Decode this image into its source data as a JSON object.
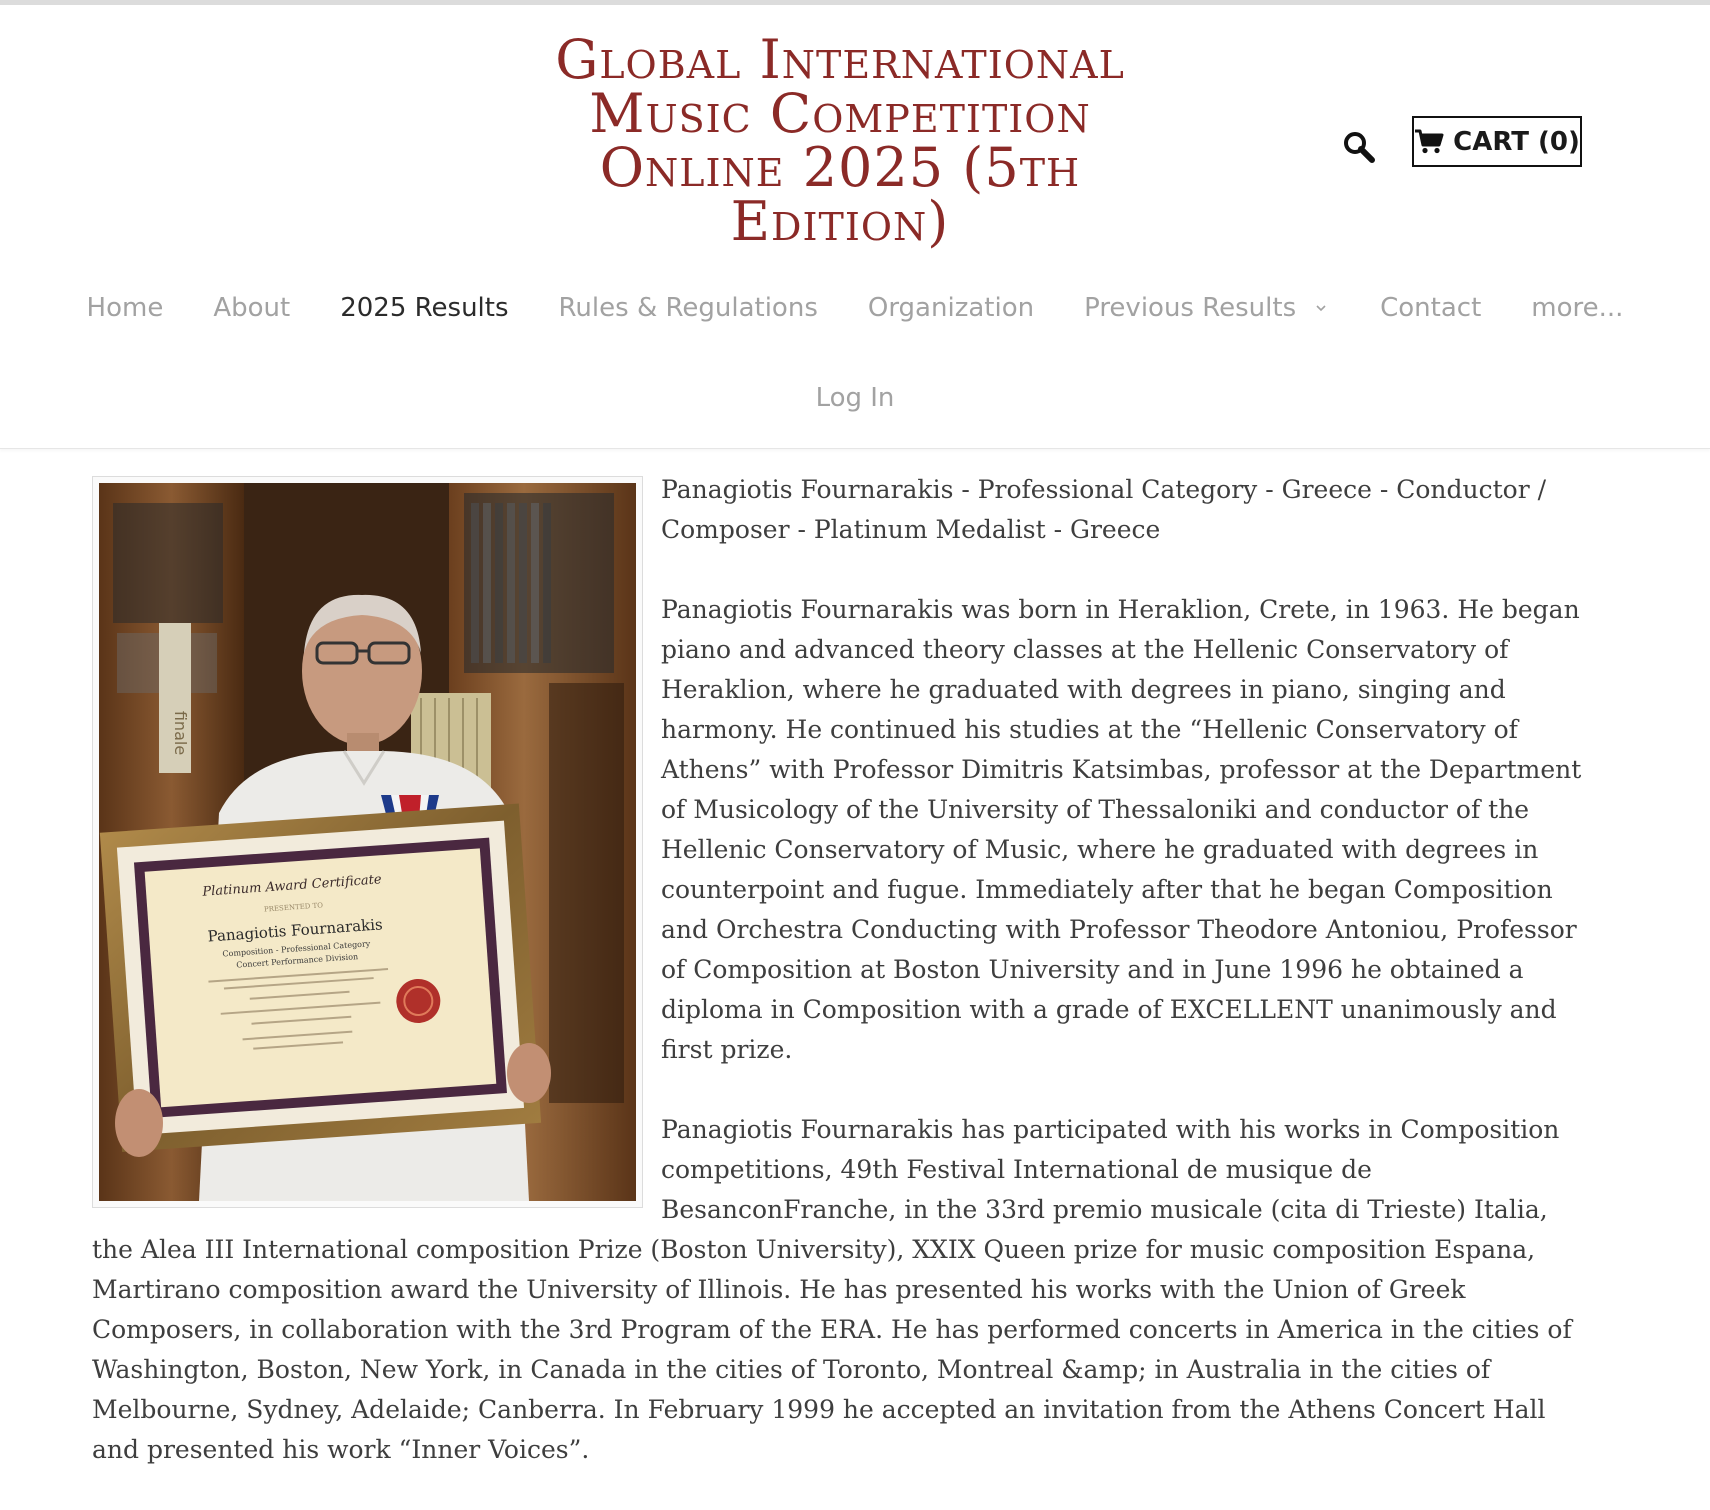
{
  "site": {
    "title": "Global International Music Competition Online 2025 (5th Edition)"
  },
  "header": {
    "cart_label": "CART (0)",
    "search_icon": "magnifier-icon",
    "cart_icon": "shopping-cart-icon"
  },
  "nav": {
    "items": [
      {
        "label": "Home"
      },
      {
        "label": "About"
      },
      {
        "label": "2025 Results",
        "active": true
      },
      {
        "label": "Rules & Regulations"
      },
      {
        "label": "Organization"
      },
      {
        "label": "Previous Results",
        "has_dropdown": true
      },
      {
        "label": "Contact"
      },
      {
        "label": "more..."
      }
    ],
    "login_label": "Log In"
  },
  "article": {
    "image_alt": "Man holding a framed Platinum Award Certificate with a medal",
    "certificate": {
      "heading": "Platinum Award Certificate",
      "presented": "PRESENTED TO",
      "name": "Panagiotis Fournarakis",
      "line1": "Composition - Professional Category",
      "line2": "Concert Performance Division"
    },
    "spine_label": "finale",
    "heading": "Panagiotis Fournarakis - Professional Category - Greece - Conductor / Composer - Platinum Medalist - Greece",
    "paragraphs": [
      "Panagiotis Fournarakis was born in Heraklion, Crete, in 1963. He began piano and advanced theory classes at the Hellenic Conservatory of Heraklion, where he graduated with degrees in piano, singing and harmony. He continued his studies at the “Hellenic Conservatory of Athens” with Professor Dimitris Katsimbas, professor at the Department of Musicology of the University of Thessaloniki and conductor of the Hellenic Conservatory of Music, where he graduated with degrees in counterpoint and fugue. Immediately after that he began Composition and Orchestra Conducting with Professor Theodore Antoniou, Professor of Composition at Boston University and in June 1996 he obtained a diploma in Composition with a grade of EXCELLENT unanimously and first prize.",
      "Panagiotis Fournarakis has participated with his works in Composition competitions, 49th Festival International de musique de BesanconFranche, in the 33rd premio musicale (cita di Trieste) Italia, the Alea III International composition Prize (Boston University), XXIX Queen prize for music composition Espana, Martirano composition award the University of Illinois. He has presented his works with the Union of Greek Composers, in collaboration with the 3rd Program of the ERA.  He has performed concerts in America in the cities of Washington, Boston, New York, in Canada in the cities of Toronto, Montreal &amp; in Australia in the cities of Melbourne, Sydney, Adelaide; Canberra. In February 1999 he accepted an invitation from the Athens Concert Hall and presented his work “Inner Voices”."
    ]
  },
  "colors": {
    "title": "#8b2a27",
    "nav_inactive": "#a2a2a2",
    "nav_active": "#2b2b2b",
    "body_text": "#3e3e3e"
  }
}
